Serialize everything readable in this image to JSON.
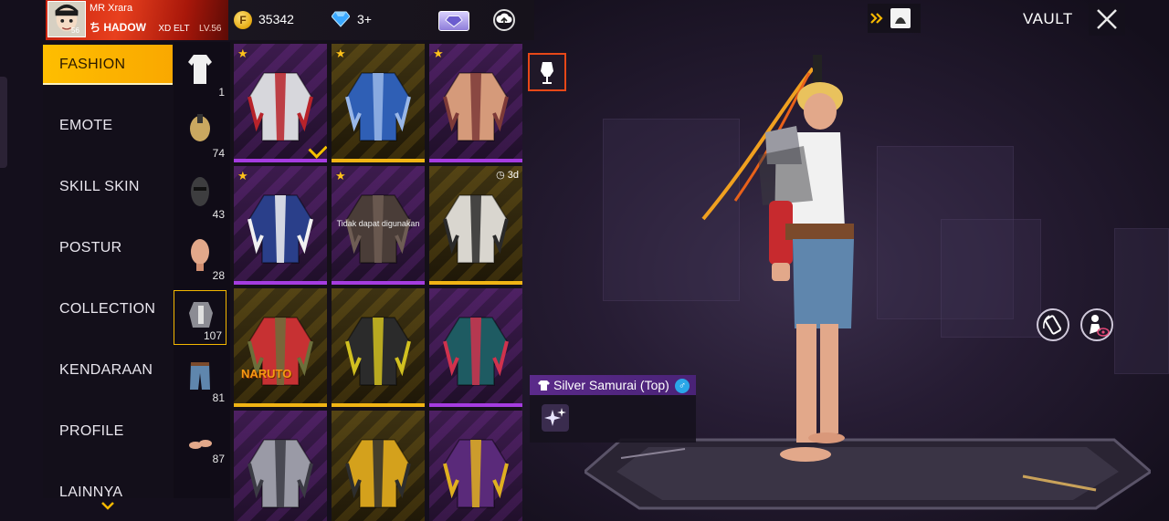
{
  "profile": {
    "avatar_level": "56",
    "name_top": "MR Xrara",
    "name_bottom": "ち HADOW",
    "name_suffix": "XD ELT",
    "level_label": "LV.56"
  },
  "currency": {
    "coin_symbol": "F",
    "coins": "35342",
    "diamonds": "3+"
  },
  "header": {
    "vault_label": "VAULT"
  },
  "categories": [
    {
      "label": "FASHION",
      "active": true
    },
    {
      "label": "EMOTE",
      "active": false
    },
    {
      "label": "SKILL SKIN",
      "active": false
    },
    {
      "label": "POSTUR",
      "active": false
    },
    {
      "label": "COLLECTION",
      "active": false
    },
    {
      "label": "KENDARAAN",
      "active": false
    },
    {
      "label": "PROFILE",
      "active": false
    },
    {
      "label": "LAINNYA",
      "active": false
    }
  ],
  "subcategories": [
    {
      "icon": "shirt-icon",
      "count": "1"
    },
    {
      "icon": "hair-icon",
      "count": "74"
    },
    {
      "icon": "mask-icon",
      "count": "43"
    },
    {
      "icon": "face-icon",
      "count": "28"
    },
    {
      "icon": "top-icon",
      "count": "107",
      "active": true
    },
    {
      "icon": "pants-icon",
      "count": "81"
    },
    {
      "icon": "shoes-icon",
      "count": "87"
    }
  ],
  "items": [
    {
      "rarity": "purple",
      "star": true,
      "name": "silver-jacket"
    },
    {
      "rarity": "gold",
      "star": true,
      "name": "blue-armor-top"
    },
    {
      "rarity": "purple",
      "star": true,
      "name": "bare-torso-top"
    },
    {
      "rarity": "purple",
      "star": true,
      "name": "blue-varsity-jacket"
    },
    {
      "rarity": "purple",
      "star": true,
      "name": "tattoo-top",
      "note": "Tidak dapat digunakan"
    },
    {
      "rarity": "gold",
      "star": false,
      "name": "samurai-coat",
      "timer": "3d"
    },
    {
      "rarity": "gold",
      "star": false,
      "name": "naruto-top",
      "badge": "NARUTO"
    },
    {
      "rarity": "gold",
      "star": false,
      "name": "gold-black-hoodie"
    },
    {
      "rarity": "purple",
      "star": false,
      "name": "teal-red-jacket"
    },
    {
      "rarity": "purple",
      "star": false,
      "name": "silver-armor-top"
    },
    {
      "rarity": "gold",
      "star": false,
      "name": "gold-armor-top"
    },
    {
      "rarity": "purple",
      "star": false,
      "name": "purple-gold-top"
    }
  ],
  "selected_item": {
    "title": "Silver Samurai (Top)",
    "gender_symbol": "♂"
  },
  "icons": {
    "more": "chevron-down-icon",
    "close": "close-icon",
    "vault_nav": "double-chevron-icon",
    "mannequin": "mannequin-icon",
    "rotate": "rotate-phone-icon",
    "preview": "preview-character-icon"
  },
  "colors": {
    "accent": "#ffbe00",
    "rarity_purple": "#a53ce0",
    "rarity_gold": "#f1b414",
    "title_bar": "#5b2a8a"
  }
}
